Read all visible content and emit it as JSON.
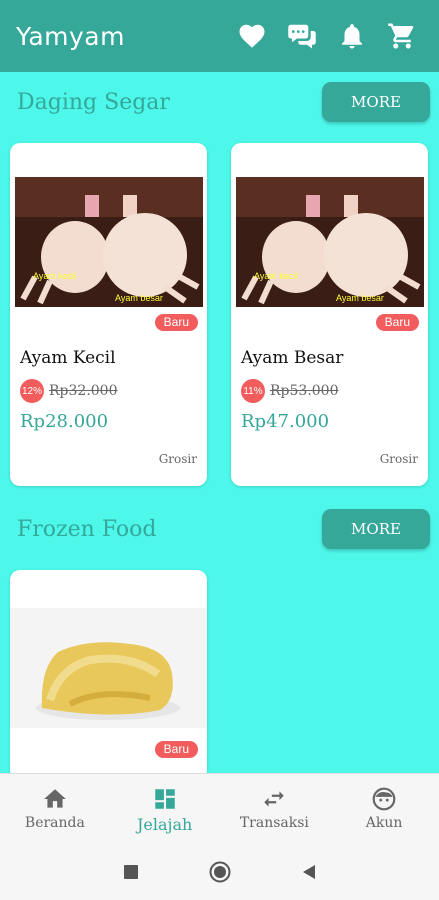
{
  "app": {
    "title": "Yamyam"
  },
  "header_icons": [
    "heart-icon",
    "chat-icon",
    "bell-icon",
    "cart-icon"
  ],
  "sections": [
    {
      "title": "Daging Segar",
      "more_label": "MORE",
      "products": [
        {
          "name": "Ayam Kecil",
          "badge": "Baru",
          "discount": "12%",
          "old_price": "Rp32.000",
          "price": "Rp28.000",
          "tag": "Grosir",
          "img_label_1": "Ayam kecil",
          "img_label_2": "Ayam besar"
        },
        {
          "name": "Ayam Besar",
          "badge": "Baru",
          "discount": "11%",
          "old_price": "Rp53.000",
          "price": "Rp47.000",
          "tag": "Grosir",
          "img_label_1": "Ayam kecil",
          "img_label_2": "Ayam besar"
        }
      ]
    },
    {
      "title": "Frozen Food",
      "more_label": "MORE",
      "products": [
        {
          "badge": "Baru"
        }
      ]
    }
  ],
  "bottom_nav": [
    {
      "label": "Beranda",
      "icon": "home-icon",
      "active": false
    },
    {
      "label": "Jelajah",
      "icon": "dashboard-icon",
      "active": true
    },
    {
      "label": "Transaksi",
      "icon": "swap-icon",
      "active": false
    },
    {
      "label": "Akun",
      "icon": "face-icon",
      "active": false
    }
  ],
  "colors": {
    "accent": "#35a89a",
    "background": "#4df7ea",
    "badge": "#f25c5c"
  }
}
